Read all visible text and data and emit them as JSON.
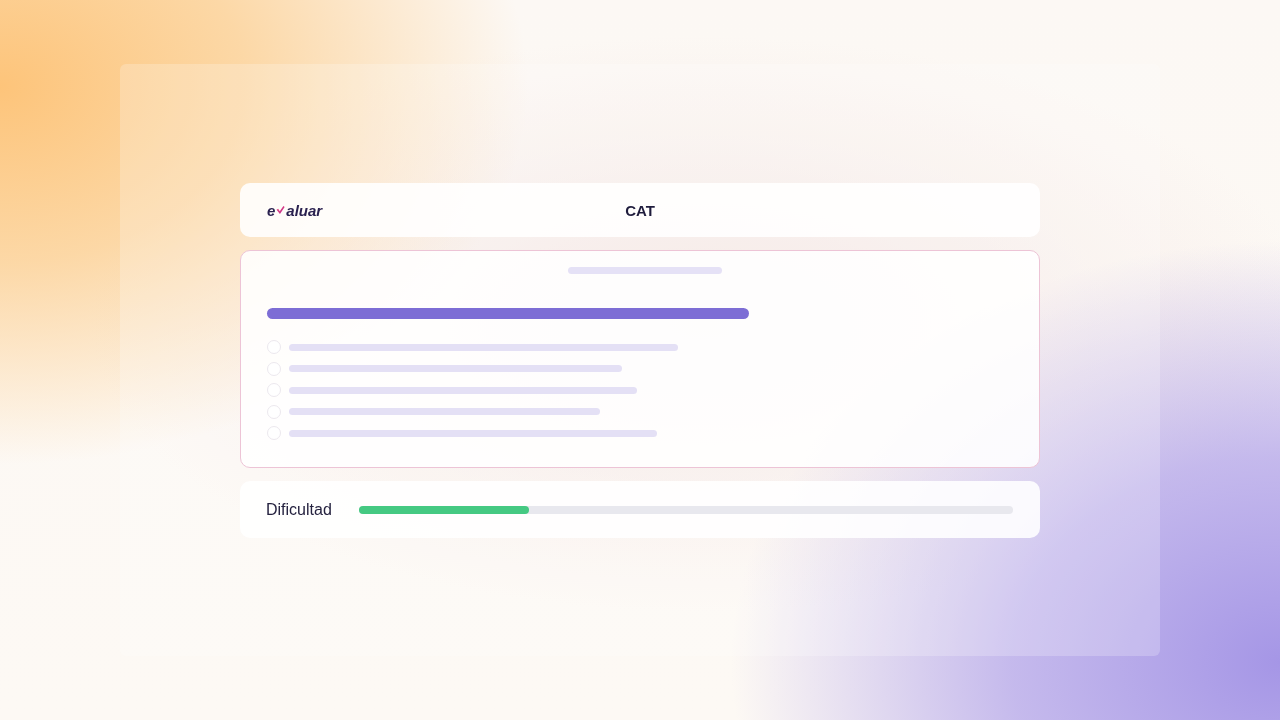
{
  "header": {
    "logo": {
      "before": "e",
      "after": "aluar"
    },
    "title": "CAT"
  },
  "question": {
    "options": [
      {
        "selected": false
      },
      {
        "selected": false
      },
      {
        "selected": false
      },
      {
        "selected": false
      },
      {
        "selected": false
      }
    ]
  },
  "difficulty": {
    "label": "Dificultad",
    "level": 0.26
  }
}
